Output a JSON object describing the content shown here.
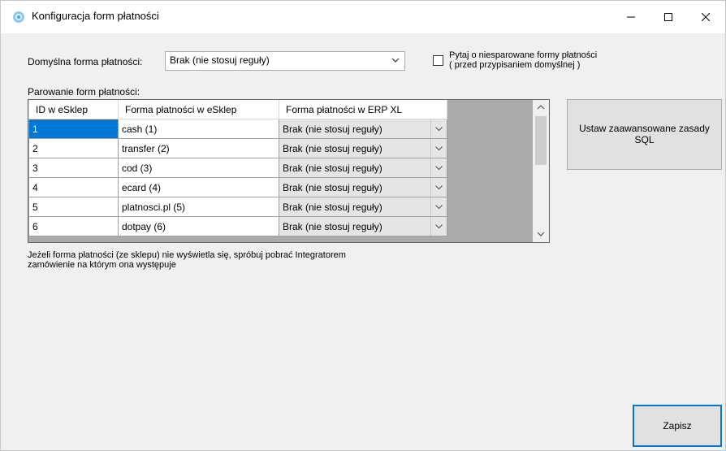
{
  "window": {
    "title": "Konfiguracja form płatności"
  },
  "default_payment": {
    "label": "Domyślna forma płatności:",
    "value": "Brak (nie stosuj reguły)"
  },
  "ask_checkbox": {
    "checked": false,
    "line1": "Pytaj o niesparowane formy płatności",
    "line2": "( przed przypisaniem domyślnej )"
  },
  "pairing": {
    "label": "Parowanie form płatności:",
    "columns": [
      "ID w eSklep",
      "Forma płatności w eSklep",
      "Forma płatności w ERP XL"
    ],
    "rows": [
      {
        "id": "1",
        "esklep": "cash (1)",
        "erp": "Brak (nie stosuj reguły)"
      },
      {
        "id": "2",
        "esklep": "transfer (2)",
        "erp": "Brak (nie stosuj reguły)"
      },
      {
        "id": "3",
        "esklep": "cod (3)",
        "erp": "Brak (nie stosuj reguły)"
      },
      {
        "id": "4",
        "esklep": "ecard (4)",
        "erp": "Brak (nie stosuj reguły)"
      },
      {
        "id": "5",
        "esklep": "platnosci.pl (5)",
        "erp": "Brak (nie stosuj reguły)"
      },
      {
        "id": "6",
        "esklep": "dotpay (6)",
        "erp": "Brak (nie stosuj reguły)"
      }
    ]
  },
  "info_text": {
    "line1": "Jeżeli forma płatności (ze sklepu) nie wyświetla się, spróbuj pobrać Integratorem",
    "line2": "zamówienie na którym ona występuje"
  },
  "buttons": {
    "sql_line1": "Ustaw zaawansowane zasady",
    "sql_line2": "SQL",
    "save": "Zapisz"
  },
  "colors": {
    "selection": "#0078d7",
    "grid_bg": "#ababab"
  }
}
